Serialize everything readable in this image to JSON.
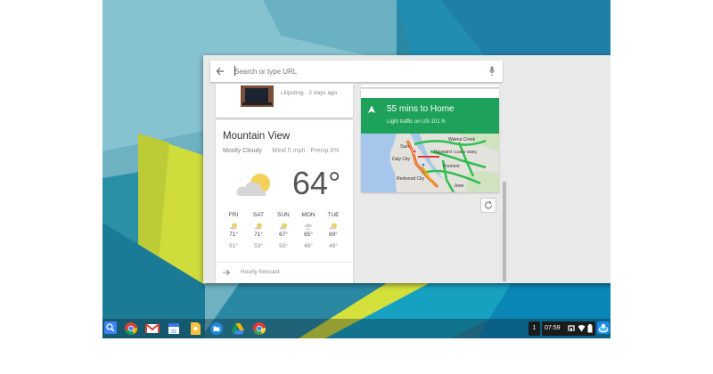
{
  "search": {
    "placeholder": "Search or type URL"
  },
  "news_card": {
    "source_time": "Liliputing · 2 days ago"
  },
  "weather": {
    "city": "Mountain View",
    "condition": "Mostly Cloudy",
    "details": "Wind 5 mph · Precip 0%",
    "temperature": "64°",
    "icon": "partly-cloudy-icon",
    "forecast": [
      {
        "day": "FRI",
        "high": "71°",
        "low": "51°",
        "icon": "partly-sunny-icon"
      },
      {
        "day": "SAT",
        "high": "71°",
        "low": "53°",
        "icon": "partly-sunny-icon"
      },
      {
        "day": "SUN",
        "high": "67°",
        "low": "50°",
        "icon": "partly-sunny-icon"
      },
      {
        "day": "MON",
        "high": "65°",
        "low": "48°",
        "icon": "showers-icon"
      },
      {
        "day": "TUE",
        "high": "69°",
        "low": "49°",
        "icon": "partly-sunny-icon"
      }
    ],
    "hourly_link": "Hourly forecast"
  },
  "traffic": {
    "title": "55 mins to Home",
    "subtitle": "Light traffic on US-101 N",
    "map_labels": [
      "San",
      "Daly City",
      "Redwood City",
      "Hayward",
      "Fremont",
      "Walnut Creek",
      "Castro Valley",
      "Jose"
    ]
  },
  "shelf": {
    "apps": [
      "search-app-icon",
      "chrome-icon",
      "gmail-icon",
      "calendar-icon",
      "keep-icon",
      "files-icon",
      "drive-icon",
      "chrome-canary-icon"
    ],
    "notification_count": "1",
    "time": "07:59"
  },
  "colors": {
    "traffic_green": "#1ea15a",
    "wallpaper_teal": "#2a8aa6",
    "wallpaper_yellow": "#d4e03c",
    "shelf_accent": "#3b82f6"
  }
}
